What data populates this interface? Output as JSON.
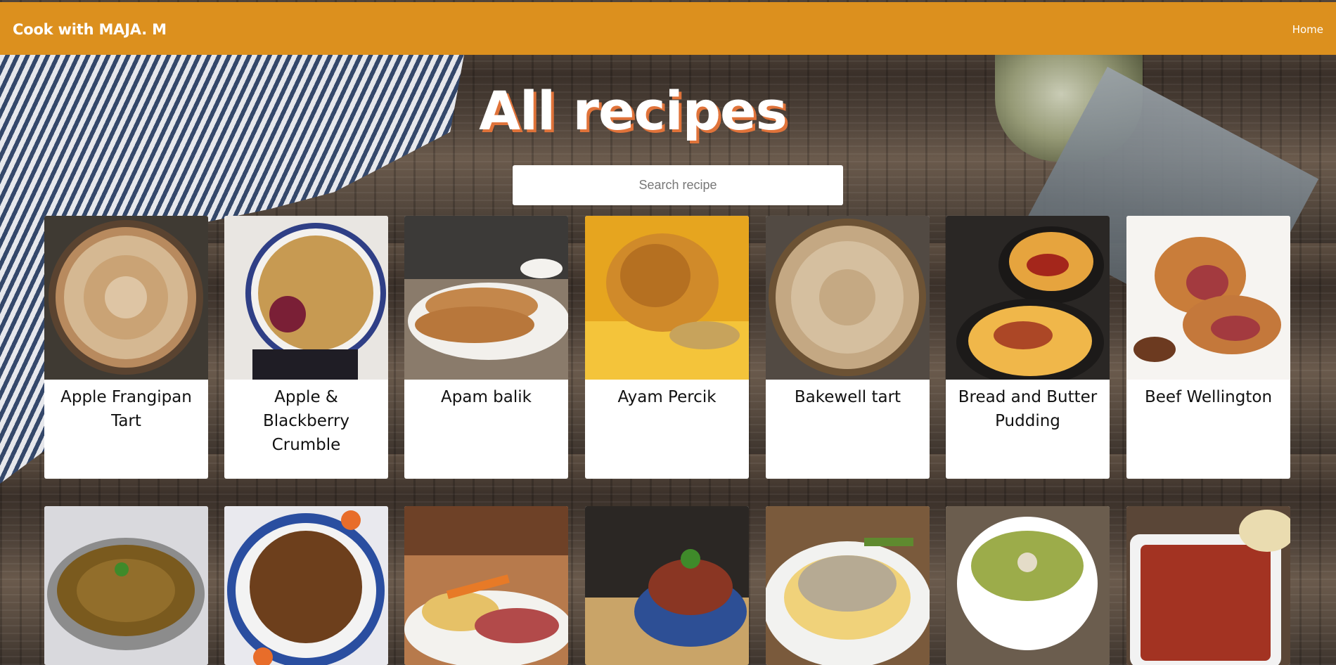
{
  "header": {
    "brand": "Cook with MAJA. M",
    "nav_home": "Home",
    "bg_color": "#dc901e"
  },
  "hero": {
    "title": "All recipes",
    "title_shadow_color": "#e0733a"
  },
  "search": {
    "placeholder": "Search recipe",
    "value": ""
  },
  "recipes_row1": [
    {
      "name": "Apple Frangipan Tart"
    },
    {
      "name": "Apple & Blackberry Crumble"
    },
    {
      "name": "Apam balik"
    },
    {
      "name": "Ayam Percik"
    },
    {
      "name": "Bakewell tart"
    },
    {
      "name": "Bread and Butter Pudding"
    },
    {
      "name": "Beef Wellington"
    }
  ],
  "recipes_row2": [
    {
      "name": ""
    },
    {
      "name": ""
    },
    {
      "name": ""
    },
    {
      "name": ""
    },
    {
      "name": ""
    },
    {
      "name": ""
    },
    {
      "name": ""
    }
  ]
}
